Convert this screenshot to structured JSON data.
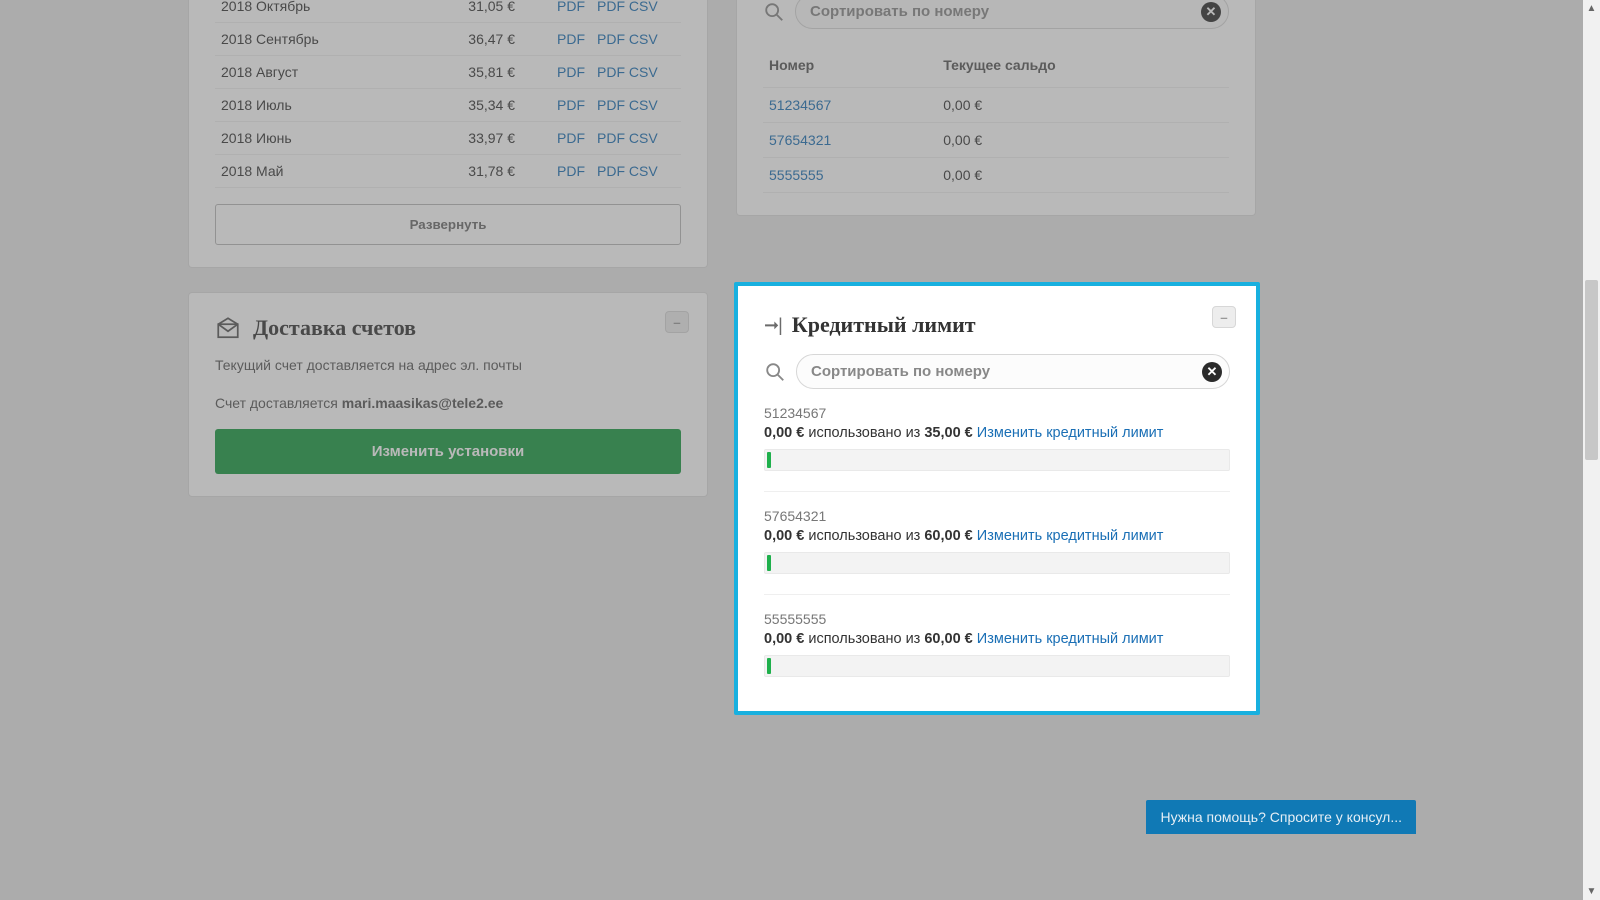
{
  "invoices": {
    "rows": [
      {
        "period": "2018 Октябрь",
        "amount": "31,05 €",
        "l1": "PDF",
        "l2": "PDF",
        "l3": "CSV"
      },
      {
        "period": "2018 Сентябрь",
        "amount": "36,47 €",
        "l1": "PDF",
        "l2": "PDF",
        "l3": "CSV"
      },
      {
        "period": "2018 Август",
        "amount": "35,81 €",
        "l1": "PDF",
        "l2": "PDF",
        "l3": "CSV"
      },
      {
        "period": "2018 Июль",
        "amount": "35,34 €",
        "l1": "PDF",
        "l2": "PDF",
        "l3": "CSV"
      },
      {
        "period": "2018 Июнь",
        "amount": "33,97 €",
        "l1": "PDF",
        "l2": "PDF",
        "l3": "CSV"
      },
      {
        "period": "2018 Май",
        "amount": "31,78 €",
        "l1": "PDF",
        "l2": "PDF",
        "l3": "CSV"
      }
    ],
    "expand_label": "Развернуть"
  },
  "delivery": {
    "title": "Доставка счетов",
    "line1": "Текущий счет доставляется на адрес эл. почты",
    "line2_prefix": "Счет доставляется ",
    "email": "mari.maasikas@tele2.ee",
    "btn": "Изменить установки"
  },
  "balance": {
    "search_placeholder": "Сортировать по номеру",
    "col_num": "Номер",
    "col_bal": "Текущее сальдо",
    "rows": [
      {
        "num": "51234567",
        "bal": "0,00 €"
      },
      {
        "num": "57654321",
        "bal": "0,00 €"
      },
      {
        "num": "5555555",
        "bal": "0,00 €"
      }
    ]
  },
  "credit": {
    "title": "Кредитный лимит",
    "search_placeholder": "Сортировать по номеру",
    "used_word": "использовано из",
    "change_link": "Изменить кредитный лимит",
    "items": [
      {
        "num": "51234567",
        "used": "0,00 €",
        "limit": "35,00 €"
      },
      {
        "num": "57654321",
        "used": "0,00 €",
        "limit": "60,00 €"
      },
      {
        "num": "55555555",
        "used": "0,00 €",
        "limit": "60,00 €"
      }
    ]
  },
  "chat": {
    "label": "Нужна помощь? Спросите у консул..."
  }
}
